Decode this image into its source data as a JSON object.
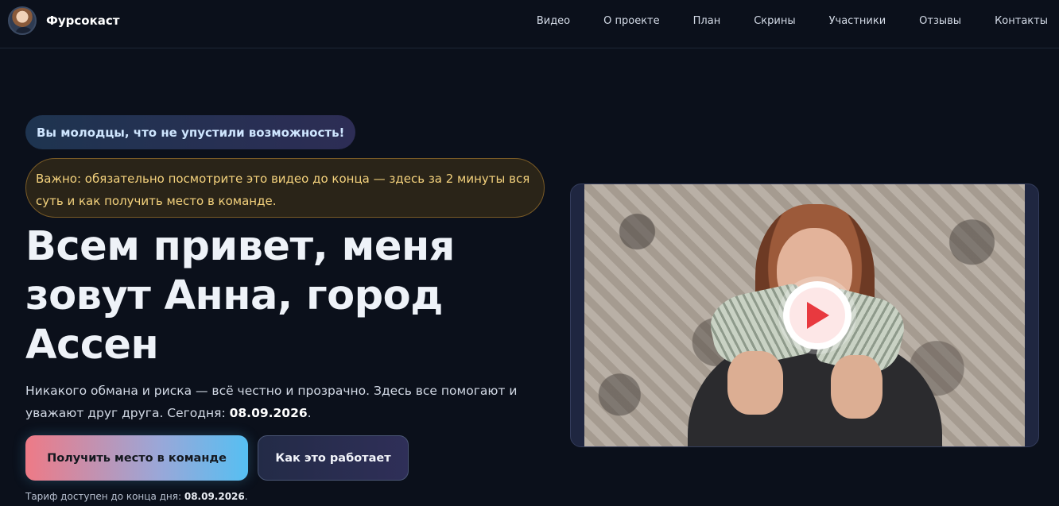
{
  "brand": {
    "name": "Фурсокаст"
  },
  "nav": {
    "items": [
      "Видео",
      "О проекте",
      "План",
      "Скрины",
      "Участники",
      "Отзывы",
      "Контакты"
    ]
  },
  "hero": {
    "pill": "Вы молодцы, что не упустили возможность!",
    "notice": "Важно: обязательно посмотрите это видео до конца — здесь за 2 минуты вся суть и как получить место в команде.",
    "headline": "Всем привет, меня зовут Анна, город Ассен",
    "subtext_prefix": "Никакого обмана и риска — всё честно и прозрачно. Здесь все помогают и уважают друг друга. Сегодня: ",
    "subtext_date": "08.09.2026",
    "subtext_suffix": ".",
    "primary_button": "Получить место в команде",
    "secondary_button": "Как это работает",
    "tariff_prefix": "Тариф доступен до конца дня: ",
    "tariff_date": "08.09.2026",
    "tariff_suffix": "."
  },
  "video": {
    "play_icon": "play-icon",
    "play_color": "#e8393f"
  }
}
